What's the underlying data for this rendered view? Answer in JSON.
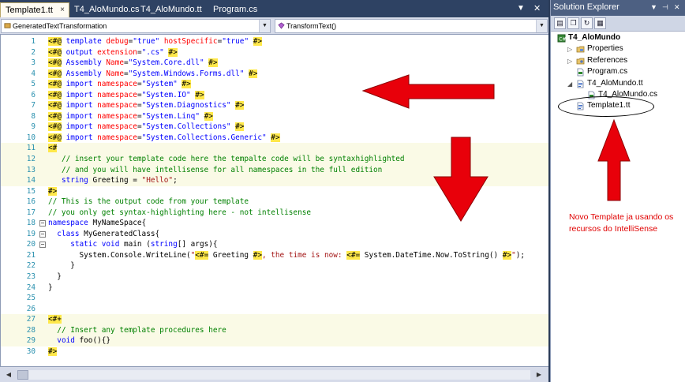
{
  "tabs": [
    {
      "label": "Template1.tt",
      "active": true
    },
    {
      "label": "T4_AloMundo.cs",
      "active": false
    },
    {
      "label": "T4_AloMundo.tt",
      "active": false
    },
    {
      "label": "Program.cs",
      "active": false
    }
  ],
  "tab_controls": {
    "menu": "▼",
    "close": "✕",
    "tab_close": "×"
  },
  "navbar": {
    "class_combo": "GeneratedTextTransformation",
    "member_combo": "TransformText()"
  },
  "code_lines": [
    {
      "n": "1",
      "hl": false,
      "fold": "",
      "tokens": [
        [
          "dir",
          "<#@"
        ],
        [
          "def",
          " "
        ],
        [
          "kw",
          "template"
        ],
        [
          "def",
          " "
        ],
        [
          "attr",
          "debug"
        ],
        [
          "def",
          "="
        ],
        [
          "attrv",
          "\"true\""
        ],
        [
          "def",
          " "
        ],
        [
          "attr",
          "hostSpecific"
        ],
        [
          "def",
          "="
        ],
        [
          "attrv",
          "\"true\""
        ],
        [
          "def",
          " "
        ],
        [
          "dir",
          "#>"
        ]
      ]
    },
    {
      "n": "2",
      "hl": false,
      "fold": "",
      "tokens": [
        [
          "dir",
          "<#@"
        ],
        [
          "def",
          " "
        ],
        [
          "kw",
          "output"
        ],
        [
          "def",
          " "
        ],
        [
          "attr",
          "extension"
        ],
        [
          "def",
          "="
        ],
        [
          "attrv",
          "\".cs\""
        ],
        [
          "def",
          " "
        ],
        [
          "dir",
          "#>"
        ]
      ]
    },
    {
      "n": "3",
      "hl": false,
      "fold": "",
      "tokens": [
        [
          "dir",
          "<#@"
        ],
        [
          "def",
          " "
        ],
        [
          "kw",
          "Assembly"
        ],
        [
          "def",
          " "
        ],
        [
          "attr",
          "Name"
        ],
        [
          "def",
          "="
        ],
        [
          "attrv",
          "\"System.Core.dll\""
        ],
        [
          "def",
          " "
        ],
        [
          "dir",
          "#>"
        ]
      ]
    },
    {
      "n": "4",
      "hl": false,
      "fold": "",
      "tokens": [
        [
          "dir",
          "<#@"
        ],
        [
          "def",
          " "
        ],
        [
          "kw",
          "Assembly"
        ],
        [
          "def",
          " "
        ],
        [
          "attr",
          "Name"
        ],
        [
          "def",
          "="
        ],
        [
          "attrv",
          "\"System.Windows.Forms.dll\""
        ],
        [
          "def",
          " "
        ],
        [
          "dir",
          "#>"
        ]
      ]
    },
    {
      "n": "5",
      "hl": false,
      "fold": "",
      "tokens": [
        [
          "dir",
          "<#@"
        ],
        [
          "def",
          " "
        ],
        [
          "kw",
          "import"
        ],
        [
          "def",
          " "
        ],
        [
          "attr",
          "namespace"
        ],
        [
          "def",
          "="
        ],
        [
          "attrv",
          "\"System\""
        ],
        [
          "def",
          " "
        ],
        [
          "dir",
          "#>"
        ]
      ]
    },
    {
      "n": "6",
      "hl": false,
      "fold": "",
      "tokens": [
        [
          "dir",
          "<#@"
        ],
        [
          "def",
          " "
        ],
        [
          "kw",
          "import"
        ],
        [
          "def",
          " "
        ],
        [
          "attr",
          "namespace"
        ],
        [
          "def",
          "="
        ],
        [
          "attrv",
          "\"System.IO\""
        ],
        [
          "def",
          " "
        ],
        [
          "dir",
          "#>"
        ]
      ]
    },
    {
      "n": "7",
      "hl": false,
      "fold": "",
      "tokens": [
        [
          "dir",
          "<#@"
        ],
        [
          "def",
          " "
        ],
        [
          "kw",
          "import"
        ],
        [
          "def",
          " "
        ],
        [
          "attr",
          "namespace"
        ],
        [
          "def",
          "="
        ],
        [
          "attrv",
          "\"System.Diagnostics\""
        ],
        [
          "def",
          " "
        ],
        [
          "dir",
          "#>"
        ]
      ]
    },
    {
      "n": "8",
      "hl": false,
      "fold": "",
      "tokens": [
        [
          "dir",
          "<#@"
        ],
        [
          "def",
          " "
        ],
        [
          "kw",
          "import"
        ],
        [
          "def",
          " "
        ],
        [
          "attr",
          "namespace"
        ],
        [
          "def",
          "="
        ],
        [
          "attrv",
          "\"System.Linq\""
        ],
        [
          "def",
          " "
        ],
        [
          "dir",
          "#>"
        ]
      ]
    },
    {
      "n": "9",
      "hl": false,
      "fold": "",
      "tokens": [
        [
          "dir",
          "<#@"
        ],
        [
          "def",
          " "
        ],
        [
          "kw",
          "import"
        ],
        [
          "def",
          " "
        ],
        [
          "attr",
          "namespace"
        ],
        [
          "def",
          "="
        ],
        [
          "attrv",
          "\"System.Collections\""
        ],
        [
          "def",
          " "
        ],
        [
          "dir",
          "#>"
        ]
      ]
    },
    {
      "n": "10",
      "hl": false,
      "fold": "",
      "tokens": [
        [
          "dir",
          "<#@"
        ],
        [
          "def",
          " "
        ],
        [
          "kw",
          "import"
        ],
        [
          "def",
          " "
        ],
        [
          "attr",
          "namespace"
        ],
        [
          "def",
          "="
        ],
        [
          "attrv",
          "\"System.Collections.Generic\""
        ],
        [
          "def",
          " "
        ],
        [
          "dir",
          "#>"
        ]
      ]
    },
    {
      "n": "11",
      "hl": true,
      "fold": "",
      "tokens": [
        [
          "dir",
          "<#"
        ]
      ]
    },
    {
      "n": "12",
      "hl": true,
      "fold": "",
      "tokens": [
        [
          "def",
          "   "
        ],
        [
          "cm",
          "// insert your template code here the tempalte code will be syntaxhighlighted"
        ]
      ]
    },
    {
      "n": "13",
      "hl": true,
      "fold": "",
      "tokens": [
        [
          "def",
          "   "
        ],
        [
          "cm",
          "// and you will have intellisense for all namespaces in the full edition"
        ]
      ]
    },
    {
      "n": "14",
      "hl": true,
      "fold": "",
      "tokens": [
        [
          "def",
          "   "
        ],
        [
          "kw",
          "string"
        ],
        [
          "def",
          " Greeting = "
        ],
        [
          "str",
          "\"Hello\""
        ],
        [
          "def",
          ";"
        ]
      ]
    },
    {
      "n": "15",
      "hl": false,
      "fold": "",
      "tokens": [
        [
          "dir",
          "#>"
        ]
      ]
    },
    {
      "n": "16",
      "hl": false,
      "fold": "",
      "tokens": [
        [
          "cm",
          "// This is the output code from your template"
        ]
      ]
    },
    {
      "n": "17",
      "hl": false,
      "fold": "",
      "tokens": [
        [
          "cm",
          "// you only get syntax-highlighting here - not intellisense"
        ]
      ]
    },
    {
      "n": "18",
      "hl": false,
      "fold": "−",
      "tokens": [
        [
          "kw",
          "namespace"
        ],
        [
          "def",
          " MyNameSpace{"
        ]
      ]
    },
    {
      "n": "19",
      "hl": false,
      "fold": "−",
      "tokens": [
        [
          "def",
          "  "
        ],
        [
          "kw",
          "class"
        ],
        [
          "def",
          " MyGeneratedClass{"
        ]
      ]
    },
    {
      "n": "20",
      "hl": false,
      "fold": "−",
      "tokens": [
        [
          "def",
          "     "
        ],
        [
          "kw",
          "static"
        ],
        [
          "def",
          " "
        ],
        [
          "kw",
          "void"
        ],
        [
          "def",
          " main ("
        ],
        [
          "kw",
          "string"
        ],
        [
          "def",
          "[] args){"
        ]
      ]
    },
    {
      "n": "21",
      "hl": false,
      "fold": "",
      "tokens": [
        [
          "def",
          "       System.Console.WriteLine("
        ],
        [
          "str",
          "\""
        ],
        [
          "dir",
          "<#="
        ],
        [
          "def",
          " Greeting "
        ],
        [
          "dir",
          "#>"
        ],
        [
          "str",
          ", the time is now: "
        ],
        [
          "dir",
          "<#="
        ],
        [
          "def",
          " System.DateTime.Now.ToString() "
        ],
        [
          "dir",
          "#>"
        ],
        [
          "str",
          "\""
        ],
        [
          "def",
          ");"
        ]
      ]
    },
    {
      "n": "22",
      "hl": false,
      "fold": "",
      "tokens": [
        [
          "def",
          "     }"
        ]
      ]
    },
    {
      "n": "23",
      "hl": false,
      "fold": "",
      "tokens": [
        [
          "def",
          "  }"
        ]
      ]
    },
    {
      "n": "24",
      "hl": false,
      "fold": "",
      "tokens": [
        [
          "def",
          "}"
        ]
      ]
    },
    {
      "n": "25",
      "hl": false,
      "fold": "",
      "tokens": []
    },
    {
      "n": "26",
      "hl": false,
      "fold": "",
      "tokens": []
    },
    {
      "n": "27",
      "hl": true,
      "fold": "",
      "tokens": [
        [
          "dir",
          "<#+"
        ]
      ]
    },
    {
      "n": "28",
      "hl": true,
      "fold": "",
      "tokens": [
        [
          "def",
          "  "
        ],
        [
          "cm",
          "// Insert any template procedures here"
        ]
      ]
    },
    {
      "n": "29",
      "hl": true,
      "fold": "",
      "tokens": [
        [
          "def",
          "  "
        ],
        [
          "kw",
          "void"
        ],
        [
          "def",
          " foo(){}"
        ]
      ]
    },
    {
      "n": "30",
      "hl": false,
      "fold": "",
      "tokens": [
        [
          "dir",
          "#>"
        ]
      ]
    }
  ],
  "solution_explorer": {
    "title": "Solution Explorer",
    "controls": {
      "dropdown": "▼",
      "pin": "⊣",
      "close": "✕"
    },
    "toolbar": [
      {
        "icon": "properties-icon",
        "glyph": "▤"
      },
      {
        "icon": "show-all-files-icon",
        "glyph": "❐"
      },
      {
        "icon": "refresh-icon",
        "glyph": "↻"
      },
      {
        "icon": "view-code-icon",
        "glyph": "▦"
      }
    ],
    "tree": [
      {
        "label": "T4_AloMundo",
        "depth": 0,
        "toggle": "",
        "icon": "project-icon",
        "bold": true
      },
      {
        "label": "Properties",
        "depth": 1,
        "toggle": "▷",
        "icon": "properties-folder-icon",
        "bold": false
      },
      {
        "label": "References",
        "depth": 1,
        "toggle": "▷",
        "icon": "references-icon",
        "bold": false
      },
      {
        "label": "Program.cs",
        "depth": 1,
        "toggle": "",
        "icon": "cs-file-icon",
        "bold": false
      },
      {
        "label": "T4_AloMundo.tt",
        "depth": 1,
        "toggle": "◢",
        "icon": "tt-file-icon",
        "bold": false
      },
      {
        "label": "T4_AloMundo.cs",
        "depth": 2,
        "toggle": "",
        "icon": "cs-file-icon",
        "bold": false
      },
      {
        "label": "Template1.tt",
        "depth": 1,
        "toggle": "",
        "icon": "tt-file-icon",
        "bold": false
      }
    ]
  },
  "annotation": "Novo Template ja usando os recursos do IntelliSense",
  "colors": {
    "arrow": "#e8000a",
    "annotation": "#e00000"
  }
}
